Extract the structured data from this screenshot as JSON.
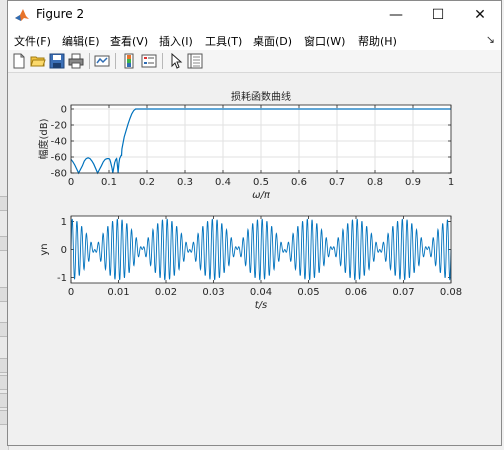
{
  "window": {
    "title": "Figure 2"
  },
  "title_buttons": {
    "minimize": "—",
    "maximize": "☐",
    "close": "✕"
  },
  "menu": {
    "items": [
      "文件(F)",
      "编辑(E)",
      "查看(V)",
      "插入(I)",
      "工具(T)",
      "桌面(D)",
      "窗口(W)",
      "帮助(H)"
    ],
    "more_arrow": "↘"
  },
  "toolbar": {
    "buttons": [
      "new-figure",
      "open-file",
      "save",
      "print",
      "link-plot",
      "insert-colorbar",
      "insert-legend",
      "edit-plot",
      "property-inspector"
    ]
  },
  "chart_data": [
    {
      "type": "line",
      "title": "损耗函数曲线",
      "xlabel": "ω/π",
      "ylabel": "幅度(dB)",
      "xlim": [
        0,
        1
      ],
      "ylim": [
        -80,
        5
      ],
      "xticks": [
        "0",
        "0.1",
        "0.2",
        "0.3",
        "0.4",
        "0.5",
        "0.6",
        "0.7",
        "0.8",
        "0.9",
        "1"
      ],
      "yticks": [
        "0",
        "-20",
        "-40",
        "-60",
        "-80"
      ],
      "grid": true,
      "color": "#0072bd",
      "series": [
        {
          "x": [
            0,
            0.005,
            0.01,
            0.02,
            0.03,
            0.035,
            0.04,
            0.045,
            0.05,
            0.055,
            0.06,
            0.07,
            0.08,
            0.085,
            0.09,
            0.095,
            0.1,
            0.102,
            0.104,
            0.106,
            0.108,
            0.11,
            0.115,
            0.118,
            0.12,
            0.121,
            0.122,
            0.124,
            0.126,
            0.128,
            0.13,
            0.132,
            0.133,
            0.134,
            0.136,
            0.14,
            0.145,
            0.15,
            0.155,
            0.16,
            0.165,
            0.17,
            0.175,
            0.18,
            1
          ],
          "y": [
            -63,
            -66,
            -70,
            -80,
            -71,
            -65,
            -62,
            -61,
            -62,
            -65,
            -69,
            -80,
            -71,
            -66,
            -63,
            -62,
            -62,
            -63,
            -66,
            -70,
            -74,
            -80,
            -67,
            -63,
            -62,
            -65,
            -70,
            -80,
            -68,
            -62,
            -60,
            -58,
            -58,
            -50,
            -45,
            -35,
            -27,
            -19,
            -12,
            -6,
            -2,
            0,
            0,
            0,
            0
          ]
        }
      ]
    },
    {
      "type": "line",
      "title": "",
      "xlabel": "t/s",
      "ylabel": "yn",
      "xlim": [
        0,
        0.08
      ],
      "ylim": [
        -1.2,
        1.2
      ],
      "xticks": [
        "0",
        "0.01",
        "0.02",
        "0.03",
        "0.04",
        "0.05",
        "0.06",
        "0.07",
        "0.08"
      ],
      "yticks": [
        "1",
        "0",
        "-1"
      ],
      "grid": false,
      "color": "#0072bd",
      "signal_note": "dense oscillating waveform, amplitude ≈ ±1, beating envelope",
      "series": [
        {
          "components": [
            {
              "amplitude": 0.55,
              "frequency_hz": 950
            },
            {
              "amplitude": 0.55,
              "frequency_hz": 1050
            }
          ],
          "t_start": 0,
          "t_end": 0.08
        }
      ]
    }
  ]
}
